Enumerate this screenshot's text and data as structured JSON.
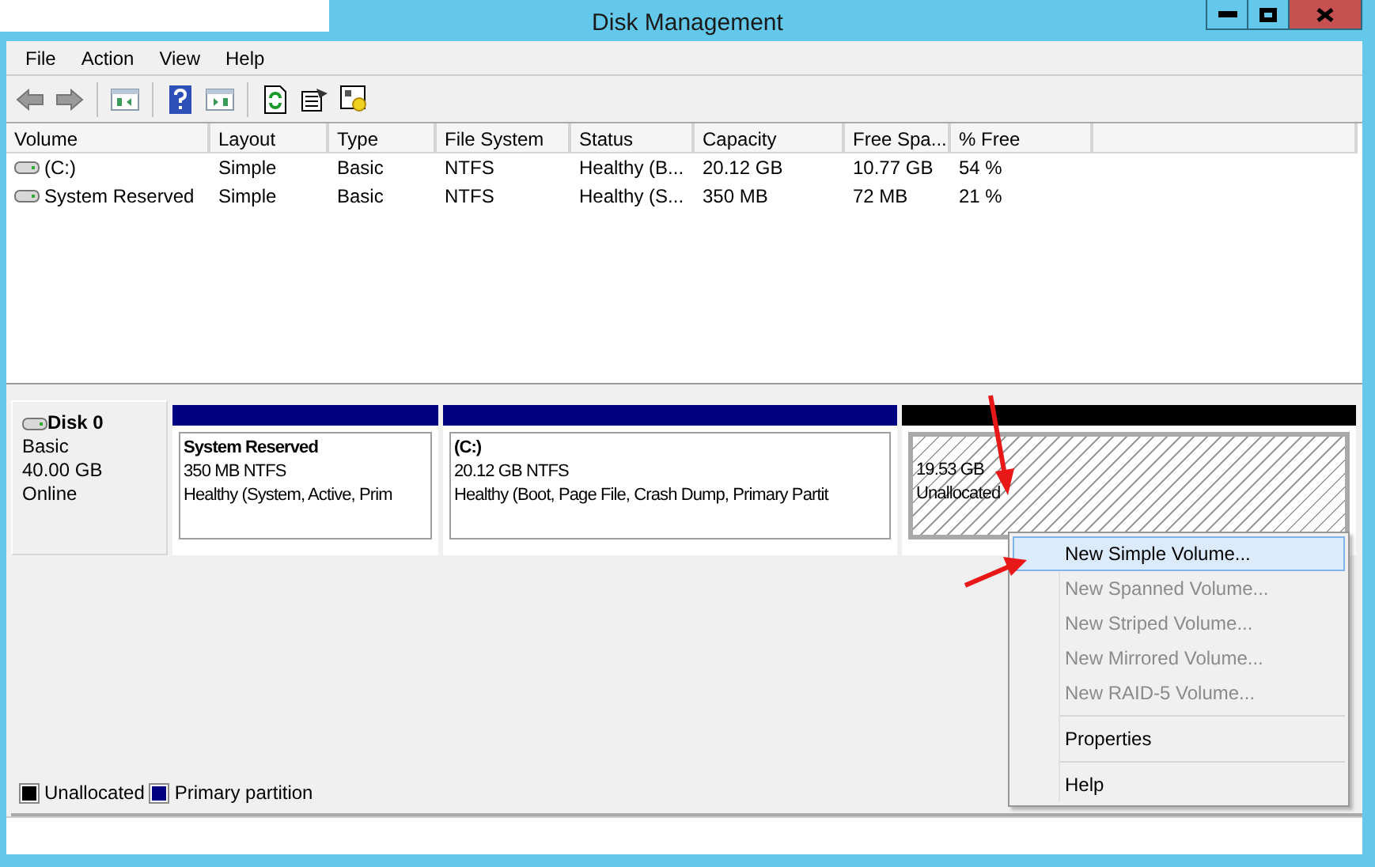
{
  "window": {
    "title": "Disk Management"
  },
  "menu": [
    "File",
    "Action",
    "View",
    "Help"
  ],
  "volume_table": {
    "columns": [
      "Volume",
      "Layout",
      "Type",
      "File System",
      "Status",
      "Capacity",
      "Free Spa...",
      "% Free"
    ],
    "rows": [
      {
        "cells": [
          "(C:)",
          "Simple",
          "Basic",
          "NTFS",
          "Healthy (B...",
          "20.12 GB",
          "10.77 GB",
          "54 %"
        ]
      },
      {
        "cells": [
          "System Reserved",
          "Simple",
          "Basic",
          "NTFS",
          "Healthy (S...",
          "350 MB",
          "72 MB",
          "21 %"
        ]
      }
    ]
  },
  "disk": {
    "name": "Disk 0",
    "type": "Basic",
    "size": "40.00 GB",
    "status": "Online",
    "partitions": [
      {
        "kind": "primary",
        "color": "#000080",
        "title": "System Reserved",
        "size": "350 MB NTFS",
        "status": "Healthy (System, Active, Prim"
      },
      {
        "kind": "primary",
        "color": "#000080",
        "title": "(C:)",
        "size": "20.12 GB NTFS",
        "status": "Healthy (Boot, Page File, Crash Dump, Primary Partit"
      },
      {
        "kind": "unallocated",
        "color": "#000000",
        "size": "19.53 GB",
        "status": "Unallocated"
      }
    ]
  },
  "legend": [
    {
      "label": "Unallocated",
      "color": "#000000"
    },
    {
      "label": "Primary partition",
      "color": "#000080"
    }
  ],
  "context_menu": [
    {
      "kind": "item",
      "label": "New Simple Volume...",
      "disabled": false,
      "selected": true
    },
    {
      "kind": "item",
      "label": "New Spanned Volume...",
      "disabled": true,
      "selected": false
    },
    {
      "kind": "item",
      "label": "New Striped Volume...",
      "disabled": true,
      "selected": false
    },
    {
      "kind": "item",
      "label": "New Mirrored Volume...",
      "disabled": true,
      "selected": false
    },
    {
      "kind": "item",
      "label": "New RAID-5 Volume...",
      "disabled": true,
      "selected": false
    },
    {
      "kind": "separator"
    },
    {
      "kind": "item",
      "label": "Properties",
      "disabled": false,
      "selected": false
    },
    {
      "kind": "separator"
    },
    {
      "kind": "item",
      "label": "Help",
      "disabled": false,
      "selected": false
    }
  ]
}
